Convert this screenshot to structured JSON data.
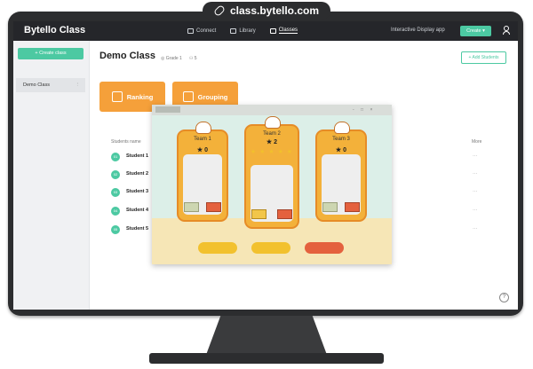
{
  "url_bar": {
    "url": "class.bytello.com"
  },
  "app": {
    "brand": "Bytello Class",
    "nav": [
      {
        "label": "Connect",
        "icon": "connect-icon"
      },
      {
        "label": "Library",
        "icon": "library-icon"
      },
      {
        "label": "Classes",
        "icon": "classes-icon",
        "active": true
      }
    ],
    "interactive_display": "Interactive Display app",
    "create_label": "Create ▾",
    "accent": "#4cc9a2"
  },
  "sidebar": {
    "create_class": "+ Create class",
    "classes": [
      {
        "label": "Demo Class",
        "more": "⋮"
      }
    ]
  },
  "main": {
    "class_title": "Demo Class",
    "grade": "Grade 1",
    "student_count": "5",
    "add_students": "+ Add Students",
    "cards": [
      {
        "label": "Ranking",
        "icon": "shield-icon"
      },
      {
        "label": "Grouping",
        "icon": "group-icon"
      }
    ],
    "table": {
      "col_name": "Students name",
      "col_more": "More",
      "rows": [
        {
          "num": "01",
          "name": "Student 1",
          "more": "···"
        },
        {
          "num": "02",
          "name": "Student 2",
          "more": "···"
        },
        {
          "num": "03",
          "name": "Student 3",
          "more": "···"
        },
        {
          "num": "04",
          "name": "Student 4",
          "more": "···"
        },
        {
          "num": "05",
          "name": "Student 5",
          "more": "···"
        }
      ]
    },
    "help": "?"
  },
  "game": {
    "teams": [
      {
        "name": "Team 1",
        "score": "0",
        "stars": ""
      },
      {
        "name": "Team 2",
        "score": "2",
        "stars": "★ ★ ★ ★ ★"
      },
      {
        "name": "Team 3",
        "score": "0",
        "stars": ""
      }
    ],
    "window_controls": "- □ ×"
  }
}
